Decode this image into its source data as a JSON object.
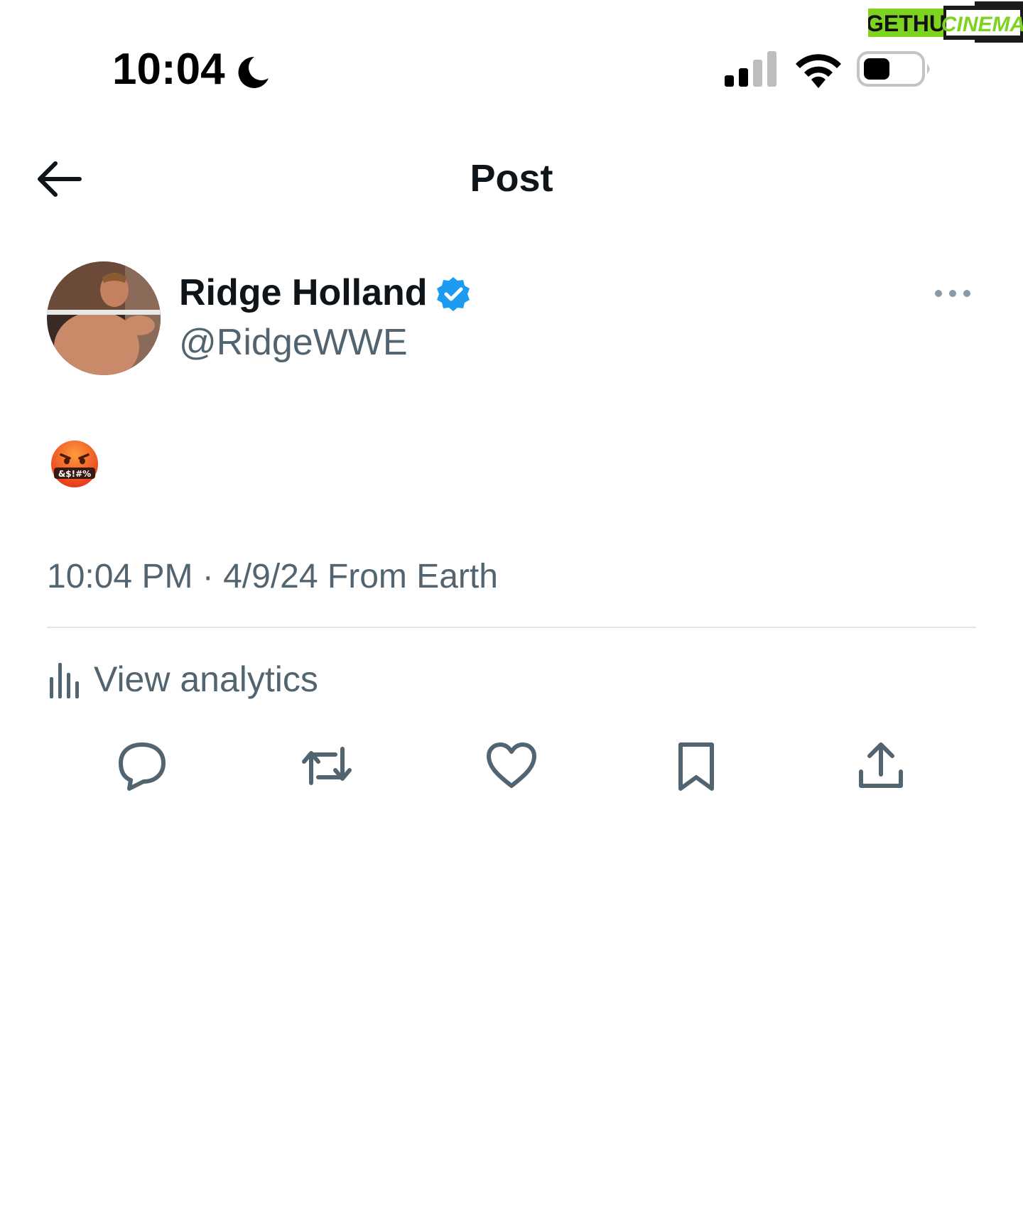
{
  "status_bar": {
    "time": "10:04",
    "icons": [
      "moon-icon",
      "signal-icon",
      "wifi-icon",
      "battery-icon"
    ]
  },
  "watermark": {
    "part1": "GETHU",
    "part2": "CINEMA",
    "colors": {
      "green": "#7ed321",
      "dark": "#1a1a1a"
    }
  },
  "header": {
    "back_icon": "arrow-left-icon",
    "title": "Post"
  },
  "post": {
    "author": {
      "name": "Ridge Holland",
      "handle": "@RidgeWWE",
      "verified": true
    },
    "more_icon": "more-horizontal-icon",
    "content_emoji": "face-with-symbols-on-mouth",
    "content_emoji_text": "&$!#%",
    "timestamp": "10:04 PM · 4/9/24 From Earth",
    "analytics_label": "View analytics"
  },
  "actions": [
    {
      "name": "reply",
      "icon": "reply-icon"
    },
    {
      "name": "repost",
      "icon": "repost-icon"
    },
    {
      "name": "like",
      "icon": "heart-icon"
    },
    {
      "name": "bookmark",
      "icon": "bookmark-icon"
    },
    {
      "name": "share",
      "icon": "share-icon"
    }
  ],
  "colors": {
    "text_primary": "#0f1419",
    "text_secondary": "#536471",
    "verified_blue": "#1d9bf0",
    "divider": "#e1e6ea"
  }
}
